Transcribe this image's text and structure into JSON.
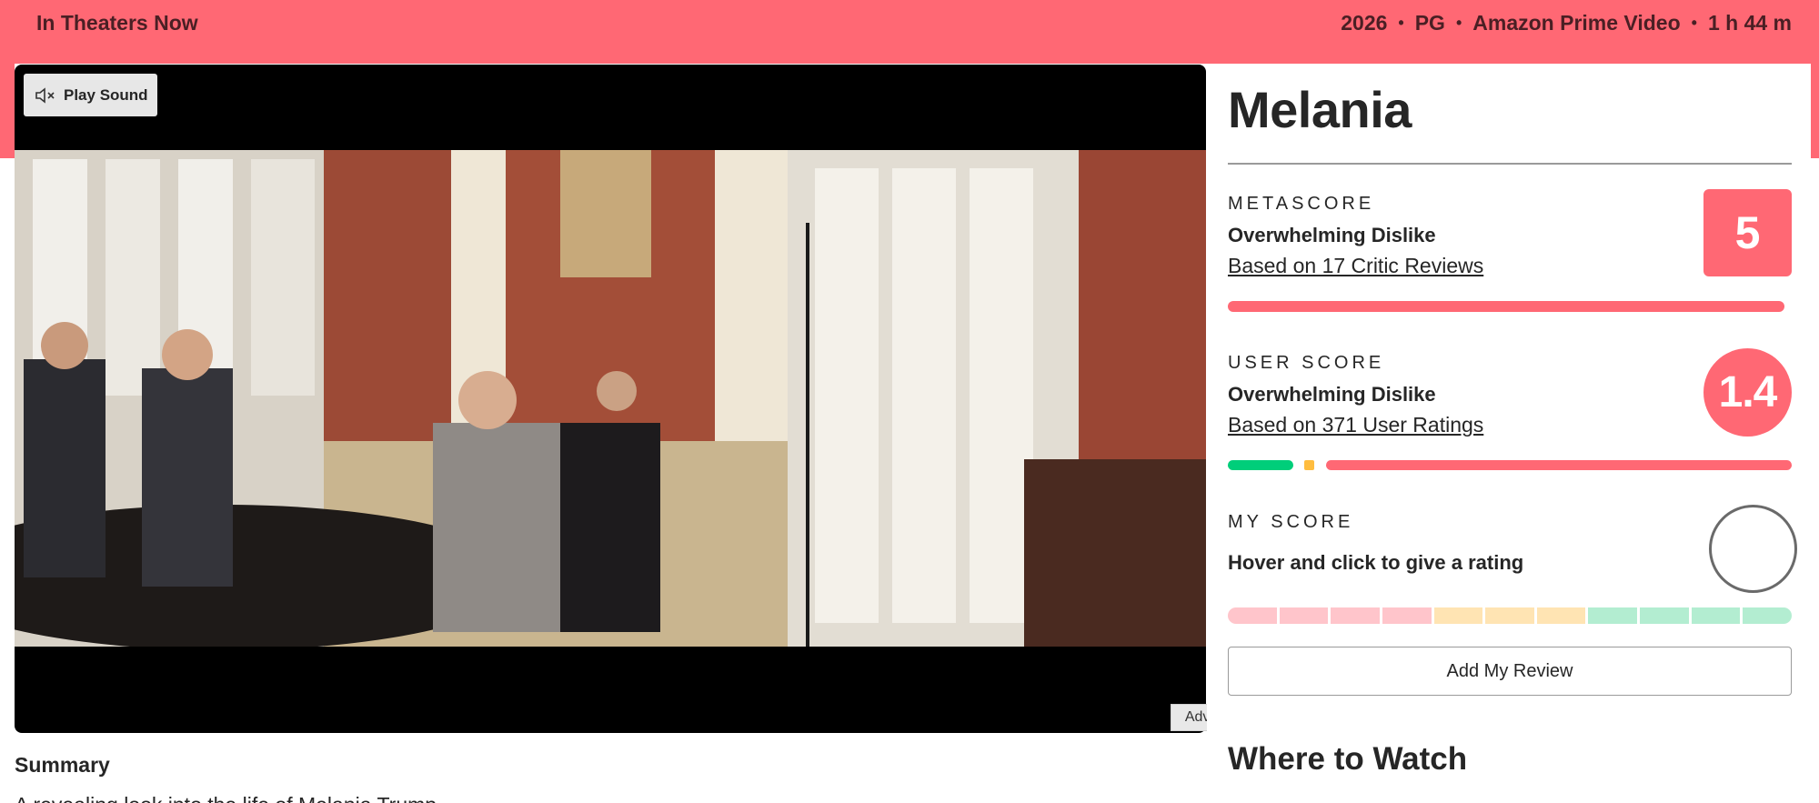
{
  "header": {
    "status": "In Theaters Now",
    "meta": [
      "2026",
      "PG",
      "Amazon Prime Video",
      "1 h 44 m"
    ],
    "separator": "•"
  },
  "video": {
    "play_sound_label": "Play Sound",
    "icon": "speaker-muted-icon"
  },
  "advertisement_label": "Advertisement",
  "summary": {
    "heading": "Summary",
    "text": "A revealing look into the life of Melania Trump"
  },
  "movie": {
    "title": "Melania"
  },
  "metascore": {
    "label": "METASCORE",
    "sentiment": "Overwhelming Dislike",
    "link": "Based on 17 Critic Reviews",
    "score": "5",
    "distribution": {
      "positive": 0,
      "mixed": 0,
      "negative": 1
    }
  },
  "user_score": {
    "label": "USER SCORE",
    "sentiment": "Overwhelming Dislike",
    "link": "Based on 371 User Ratings",
    "score": "1.4",
    "distribution": {
      "positive": 0.12,
      "mixed": 0.02,
      "negative": 0.86
    }
  },
  "my_score": {
    "label": "MY SCORE",
    "hint": "Hover and click to give a rating",
    "segments": 11
  },
  "add_review_label": "Add My Review",
  "where_to_watch_heading": "Where to Watch",
  "colors": {
    "accent": "#ff6874",
    "positive": "#00ce7a",
    "mixed": "#ffbd3f",
    "negative": "#ff6874",
    "segment_negative": "#ffc5cb",
    "segment_mixed": "#ffe4b3",
    "segment_positive": "#b3edd1"
  }
}
